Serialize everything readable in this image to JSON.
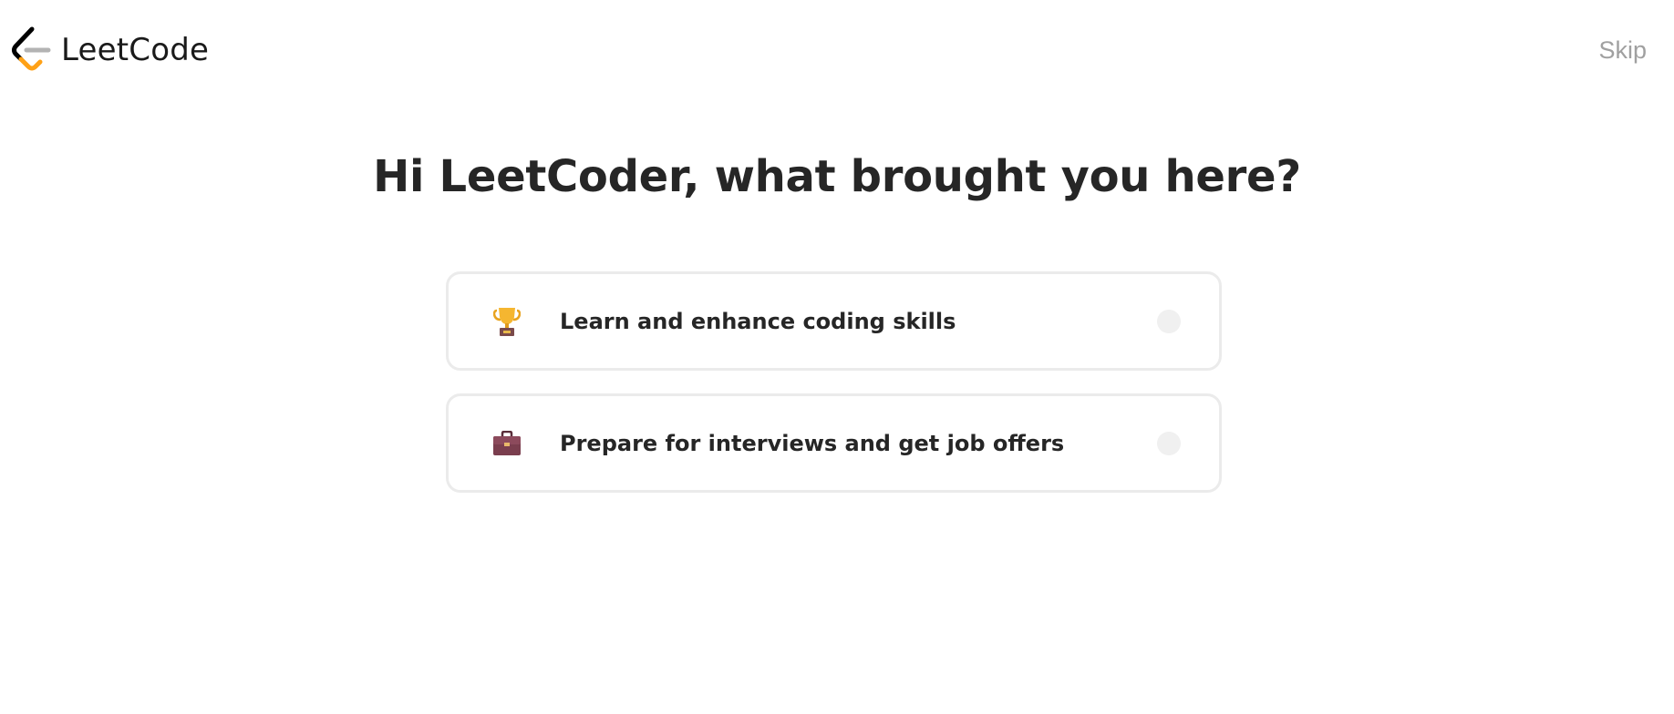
{
  "header": {
    "logo_text": "LeetCode",
    "skip_label": "Skip"
  },
  "main": {
    "title": "Hi LeetCoder, what brought you here?",
    "options": [
      {
        "icon": "trophy-icon",
        "label": "Learn and enhance coding skills",
        "selected": false
      },
      {
        "icon": "briefcase-icon",
        "label": "Prepare for interviews and get job offers",
        "selected": false
      }
    ]
  },
  "colors": {
    "logo_orange": "#FFA116",
    "logo_gray": "#B3B3B3",
    "logo_black": "#000000",
    "skip_text": "#A0A0A0",
    "option_border": "#EBEBEB",
    "radio_fill": "#F0F0F0"
  }
}
